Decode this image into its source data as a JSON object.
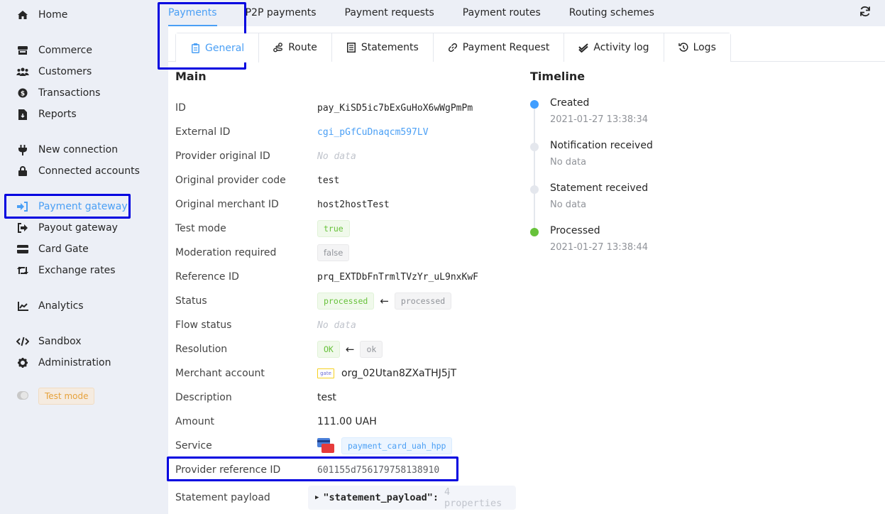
{
  "sidebar": {
    "items": [
      {
        "label": "Home",
        "icon": "home-icon"
      },
      {
        "label": "Commerce",
        "icon": "store-icon"
      },
      {
        "label": "Customers",
        "icon": "users-icon"
      },
      {
        "label": "Transactions",
        "icon": "dollar-icon"
      },
      {
        "label": "Reports",
        "icon": "file-download-icon"
      },
      {
        "label": "New connection",
        "icon": "plug-icon"
      },
      {
        "label": "Connected accounts",
        "icon": "lock-icon"
      },
      {
        "label": "Payment gateway",
        "icon": "sign-in-icon",
        "active": true
      },
      {
        "label": "Payout gateway",
        "icon": "sign-out-icon"
      },
      {
        "label": "Card Gate",
        "icon": "credit-card-icon"
      },
      {
        "label": "Exchange rates",
        "icon": "retweet-icon"
      },
      {
        "label": "Analytics",
        "icon": "chart-line-icon"
      },
      {
        "label": "Sandbox",
        "icon": "code-icon"
      },
      {
        "label": "Administration",
        "icon": "gear-icon"
      }
    ],
    "test_mode_label": "Test mode"
  },
  "top_tabs": [
    {
      "label": "Payments",
      "active": true
    },
    {
      "label": "P2P payments"
    },
    {
      "label": "Payment requests"
    },
    {
      "label": "Payment routes"
    },
    {
      "label": "Routing schemes"
    }
  ],
  "sub_tabs": [
    {
      "label": "General",
      "icon": "clipboard-icon",
      "active": true
    },
    {
      "label": "Route",
      "icon": "route-icon"
    },
    {
      "label": "Statements",
      "icon": "receipt-icon"
    },
    {
      "label": "Payment Request",
      "icon": "link-icon"
    },
    {
      "label": "Activity log",
      "icon": "double-check-icon"
    },
    {
      "label": "Logs",
      "icon": "history-icon"
    }
  ],
  "main": {
    "title": "Main",
    "fields": {
      "id": {
        "label": "ID",
        "value": "pay_KiSD5ic7bExGuHoX6wWgPmPm"
      },
      "external_id": {
        "label": "External ID",
        "value": "cgi_pGfCuDnaqcm597LV"
      },
      "provider_original_id": {
        "label": "Provider original ID",
        "value": "No data"
      },
      "original_provider_code": {
        "label": "Original provider code",
        "value": "test"
      },
      "original_merchant_id": {
        "label": "Original merchant ID",
        "value": "host2hostTest"
      },
      "test_mode": {
        "label": "Test mode",
        "value": "true"
      },
      "moderation_required": {
        "label": "Moderation required",
        "value": "false"
      },
      "reference_id": {
        "label": "Reference ID",
        "value": "prq_EXTDbFnTrmlTVzYr_uL9nxKwF"
      },
      "status": {
        "label": "Status",
        "value": "processed",
        "previous": "processed"
      },
      "flow_status": {
        "label": "Flow status",
        "value": "No data"
      },
      "resolution": {
        "label": "Resolution",
        "value": "OK",
        "previous": "ok"
      },
      "merchant_account": {
        "label": "Merchant account",
        "logo": "gate",
        "value": "org_02Utan8ZXaTHJ5jT"
      },
      "description": {
        "label": "Description",
        "value": "test"
      },
      "amount": {
        "label": "Amount",
        "value": "111.00 UAH"
      },
      "service": {
        "label": "Service",
        "value": "payment_card_uah_hpp"
      },
      "provider_reference_id": {
        "label": "Provider reference ID",
        "value": "601155d756179758138910"
      },
      "statement_payload": {
        "label": "Statement payload",
        "key": "\"statement_payload\":",
        "count": "4 properties"
      }
    }
  },
  "timeline": {
    "title": "Timeline",
    "events": [
      {
        "title": "Created",
        "sub": "2021-01-27 13:38:34",
        "color": "#409eff"
      },
      {
        "title": "Notification received",
        "sub": "No data",
        "color": "#e4e7ed"
      },
      {
        "title": "Statement received",
        "sub": "No data",
        "color": "#e4e7ed"
      },
      {
        "title": "Processed",
        "sub": "2021-01-27 13:38:44",
        "color": "#67c23a"
      }
    ]
  }
}
